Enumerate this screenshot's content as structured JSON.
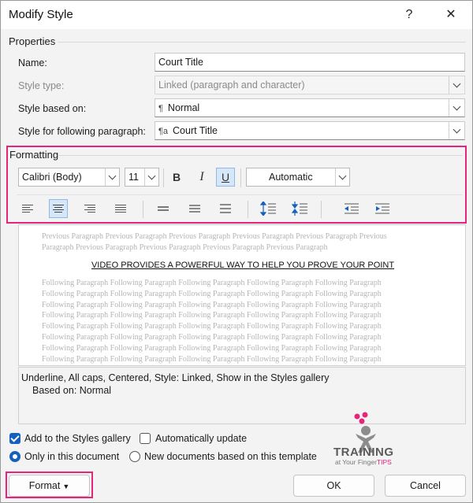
{
  "window": {
    "title": "Modify Style",
    "help_glyph": "?",
    "close_glyph": "✕"
  },
  "properties": {
    "section": "Properties",
    "name_label": "Name:",
    "name_value": "Court Title",
    "style_type_label": "Style type:",
    "style_type_value": "Linked (paragraph and character)",
    "based_on_label": "Style based on:",
    "based_on_value": "Normal",
    "following_label": "Style for following paragraph:",
    "following_value": "Court Title"
  },
  "formatting": {
    "section": "Formatting",
    "font": "Calibri (Body)",
    "size": "11",
    "bold": "B",
    "italic": "I",
    "underline": "U",
    "color": "Automatic"
  },
  "preview": {
    "previous": "Previous Paragraph Previous Paragraph Previous Paragraph Previous Paragraph Previous Paragraph Previous Paragraph Previous Paragraph Previous Paragraph Previous Paragraph Previous Paragraph",
    "sample": "VIDEO PROVIDES A POWERFUL WAY TO HELP YOU PROVE YOUR POINT",
    "following": "Following Paragraph Following Paragraph Following Paragraph Following Paragraph Following Paragraph Following Paragraph Following Paragraph Following Paragraph Following Paragraph Following Paragraph Following Paragraph Following Paragraph Following Paragraph Following Paragraph Following Paragraph Following Paragraph Following Paragraph Following Paragraph Following Paragraph Following Paragraph Following Paragraph Following Paragraph Following Paragraph Following Paragraph Following Paragraph Following Paragraph Following Paragraph Following Paragraph Following Paragraph Following Paragraph Following Paragraph Following Paragraph Following Paragraph Following Paragraph Following Paragraph Following Paragraph Following Paragraph Following Paragraph Following Paragraph Following Paragraph Following Paragraph Following Paragraph Following Paragraph Following Paragraph Following Paragraph Following Paragraph Following Paragraph Following Paragraph Following Paragraph Following Paragraph Following Paragraph Following Paragraph Following Paragraph Following Paragraph Following Paragraph Following Paragraph Following Paragraph Following Paragraph Following Paragraph Following Paragraph Following Paragraph Following Paragraph Following Paragraph Following Paragraph Following Paragraph"
  },
  "description": {
    "line1": "Underline, All caps, Centered, Style: Linked, Show in the Styles gallery",
    "line2": "Based on: Normal"
  },
  "options": {
    "add_gallery": "Add to the Styles gallery",
    "auto_update": "Automatically update",
    "only_doc": "Only in this document",
    "new_docs": "New documents based on this template"
  },
  "buttons": {
    "format": "Format",
    "ok": "OK",
    "cancel": "Cancel"
  },
  "logo": {
    "word1": "TRAINING",
    "word2a": "at Your Finger",
    "word2b": "TIPS"
  },
  "colors": {
    "accent": "#e5247b",
    "selection": "#d5e7f8",
    "check_blue": "#1560bd"
  }
}
